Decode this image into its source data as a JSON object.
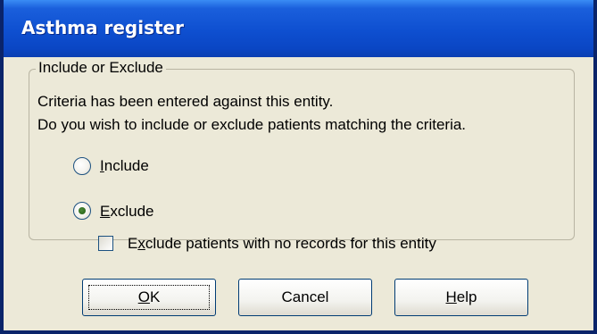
{
  "dialog": {
    "title": "Asthma register"
  },
  "group": {
    "label": "Include or Exclude",
    "message_line1": "Criteria has been entered against this entity.",
    "message_line2": "Do you wish to include or exclude patients matching the criteria."
  },
  "options": {
    "include": {
      "access_key": "I",
      "rest": "nclude",
      "selected": false
    },
    "exclude": {
      "access_key": "E",
      "rest": "xclude",
      "selected": true
    }
  },
  "checkbox": {
    "prefix": "E",
    "access_key": "x",
    "rest": "clude patients with no records for this entity",
    "checked": false
  },
  "buttons": {
    "ok": {
      "access_key": "O",
      "rest": "K"
    },
    "cancel": {
      "label": "Cancel"
    },
    "help": {
      "access_key": "H",
      "rest": "elp"
    }
  },
  "colors": {
    "titlebar": "#0a46c4",
    "dialog_bg": "#ece9d8",
    "frame": "#0a246a"
  }
}
